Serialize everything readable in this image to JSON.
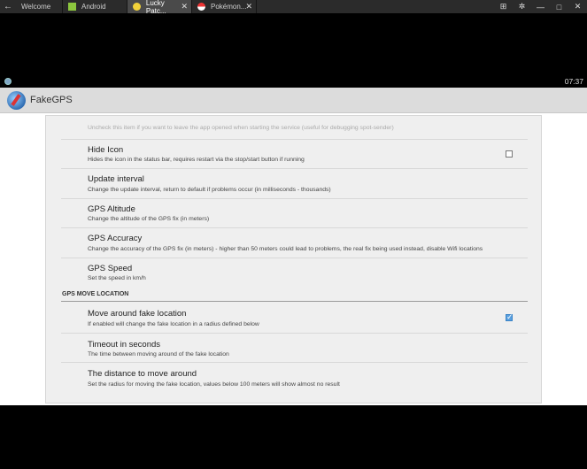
{
  "browser": {
    "back_glyph": "←",
    "tabs": [
      {
        "label": "Welcome",
        "active": false,
        "icon": "none"
      },
      {
        "label": "Android",
        "active": false,
        "icon": "android-icon"
      },
      {
        "label": "Lucky Patc...",
        "active": true,
        "icon": "lucky-patcher-icon"
      },
      {
        "label": "Pokémon...",
        "active": false,
        "icon": "pokeball-icon"
      }
    ],
    "close_glyph": "✕",
    "controls": {
      "network": "⊞",
      "settings": "✲",
      "minimize": "—",
      "maximize": "□",
      "close": "✕"
    }
  },
  "status_bar": {
    "clock": "07:37"
  },
  "app_bar": {
    "title": "FakeGPS"
  },
  "settings": {
    "faded_text": "Uncheck this item if you want to leave the app opened when starting the service (useful for debugging spot-sender)",
    "items": [
      {
        "title": "Hide Icon",
        "summary": "Hides the icon in the status bar, requires restart via the stop/start button if running",
        "checkbox": "unchecked"
      },
      {
        "title": "Update interval",
        "summary": "Change the update interval, return to default if problems occur (in milliseconds - thousands)",
        "checkbox": "none"
      },
      {
        "title": "GPS Altitude",
        "summary": "Change the altitude of the GPS fix (in meters)",
        "checkbox": "none"
      },
      {
        "title": "GPS Accuracy",
        "summary": "Change the accuracy of the GPS fix (in meters) - higher than 50 meters could lead to problems, the real fix being used instead, disable Wifi locations",
        "checkbox": "none"
      },
      {
        "title": "GPS Speed",
        "summary": "Set the speed in km/h",
        "checkbox": "none"
      }
    ],
    "category": "GPS MOVE LOCATION",
    "move_items": [
      {
        "title": "Move around fake location",
        "summary": "If enabled will change the fake location in a radius defined below",
        "checkbox": "checked"
      },
      {
        "title": "Timeout in seconds",
        "summary": "The time between moving around of the fake location",
        "checkbox": "none"
      },
      {
        "title": "The distance to move around",
        "summary": "Set the radius for moving the fake location, values below 100 meters will show almost no result",
        "checkbox": "none"
      }
    ]
  }
}
